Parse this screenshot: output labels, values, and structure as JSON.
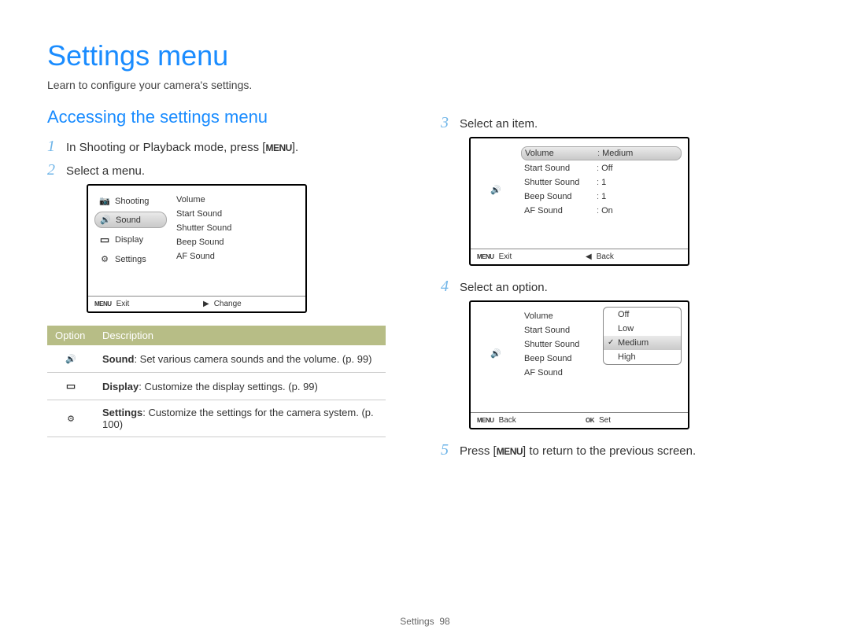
{
  "title": "Settings menu",
  "subtitle": "Learn to configure your camera's settings.",
  "section_heading": "Accessing the settings menu",
  "steps": {
    "s1_pre": "In Shooting or Playback mode, press [",
    "s1_menu": "MENU",
    "s1_post": "].",
    "s2": "Select a menu.",
    "s3": "Select an item.",
    "s4": "Select an option.",
    "s5_pre": "Press [",
    "s5_menu": "MENU",
    "s5_post": "] to return to the previous screen."
  },
  "device1": {
    "left": [
      {
        "icon": "camera",
        "label": "Shooting"
      },
      {
        "icon": "sound",
        "label": "Sound",
        "active": true
      },
      {
        "icon": "display",
        "label": "Display"
      },
      {
        "icon": "gear",
        "label": "Settings"
      }
    ],
    "right": [
      "Volume",
      "Start Sound",
      "Shutter Sound",
      "Beep Sound",
      "AF Sound"
    ],
    "footer_left_icon": "MENU",
    "footer_left": "Exit",
    "footer_right_arrow": "▶",
    "footer_right": "Change"
  },
  "opt_table": {
    "h1": "Option",
    "h2": "Description",
    "rows": [
      {
        "icon": "sound",
        "name": "Sound",
        "desc": ": Set various camera sounds and the volume. (p. 99)"
      },
      {
        "icon": "display",
        "name": "Display",
        "desc": ": Customize the display settings. (p. 99)"
      },
      {
        "icon": "gear",
        "name": "Settings",
        "desc": ": Customize the settings for the camera system. (p. 100)"
      }
    ]
  },
  "device2": {
    "side_icon": "sound",
    "items": [
      {
        "label": "Volume",
        "value": "Medium",
        "active": true
      },
      {
        "label": "Start Sound",
        "value": "Off"
      },
      {
        "label": "Shutter Sound",
        "value": "1"
      },
      {
        "label": "Beep Sound",
        "value": "1"
      },
      {
        "label": "AF Sound",
        "value": "On"
      }
    ],
    "footer_left_icon": "MENU",
    "footer_left": "Exit",
    "footer_right_arrow": "◀",
    "footer_right": "Back"
  },
  "device3": {
    "side_icon": "sound",
    "items": [
      "Volume",
      "Start Sound",
      "Shutter Sound",
      "Beep Sound",
      "AF Sound"
    ],
    "popup": [
      {
        "label": "Off"
      },
      {
        "label": "Low"
      },
      {
        "label": "Medium",
        "active": true
      },
      {
        "label": "High"
      }
    ],
    "footer_left_icon": "MENU",
    "footer_left": "Back",
    "footer_right_icon": "OK",
    "footer_right": "Set"
  },
  "footer_label": "Settings",
  "footer_page": "98"
}
